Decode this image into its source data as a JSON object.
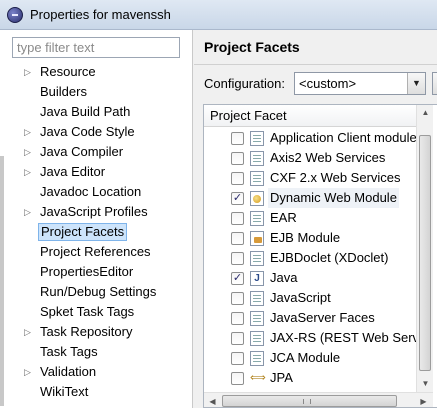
{
  "window": {
    "title": "Properties for mavenssh"
  },
  "filter": {
    "placeholder": "type filter text"
  },
  "tree": [
    {
      "label": "Resource",
      "expandable": true
    },
    {
      "label": "Builders",
      "expandable": false
    },
    {
      "label": "Java Build Path",
      "expandable": false
    },
    {
      "label": "Java Code Style",
      "expandable": true
    },
    {
      "label": "Java Compiler",
      "expandable": true
    },
    {
      "label": "Java Editor",
      "expandable": true
    },
    {
      "label": "Javadoc Location",
      "expandable": false
    },
    {
      "label": "JavaScript Profiles",
      "expandable": true
    },
    {
      "label": "Project Facets",
      "expandable": false,
      "selected": true
    },
    {
      "label": "Project References",
      "expandable": false
    },
    {
      "label": "PropertiesEditor",
      "expandable": false
    },
    {
      "label": "Run/Debug Settings",
      "expandable": false
    },
    {
      "label": "Spket Task Tags",
      "expandable": false
    },
    {
      "label": "Task Repository",
      "expandable": true
    },
    {
      "label": "Task Tags",
      "expandable": false
    },
    {
      "label": "Validation",
      "expandable": true
    },
    {
      "label": "WikiText",
      "expandable": false
    }
  ],
  "page": {
    "title": "Project Facets",
    "config_label": "Configuration:",
    "config_value": "<custom>"
  },
  "facets": {
    "header": "Project Facet",
    "rows": [
      {
        "label": "Application Client module",
        "checked": false,
        "icon": "doc-icon"
      },
      {
        "label": "Axis2 Web Services",
        "checked": false,
        "icon": "doc-icon"
      },
      {
        "label": "CXF 2.x Web Services",
        "checked": false,
        "icon": "doc-icon"
      },
      {
        "label": "Dynamic Web Module",
        "checked": true,
        "icon": "web-module-icon"
      },
      {
        "label": "EAR",
        "checked": false,
        "icon": "doc-icon"
      },
      {
        "label": "EJB Module",
        "checked": false,
        "icon": "ejb-icon"
      },
      {
        "label": "EJBDoclet (XDoclet)",
        "checked": false,
        "icon": "doc-icon"
      },
      {
        "label": "Java",
        "checked": true,
        "icon": "java-icon"
      },
      {
        "label": "JavaScript",
        "checked": false,
        "icon": "doc-icon"
      },
      {
        "label": "JavaServer Faces",
        "checked": false,
        "icon": "doc-icon"
      },
      {
        "label": "JAX-RS (REST Web Servic",
        "checked": false,
        "icon": "doc-icon"
      },
      {
        "label": "JCA Module",
        "checked": false,
        "icon": "doc-icon"
      },
      {
        "label": "JPA",
        "checked": false,
        "icon": "jpa-icon"
      }
    ]
  }
}
